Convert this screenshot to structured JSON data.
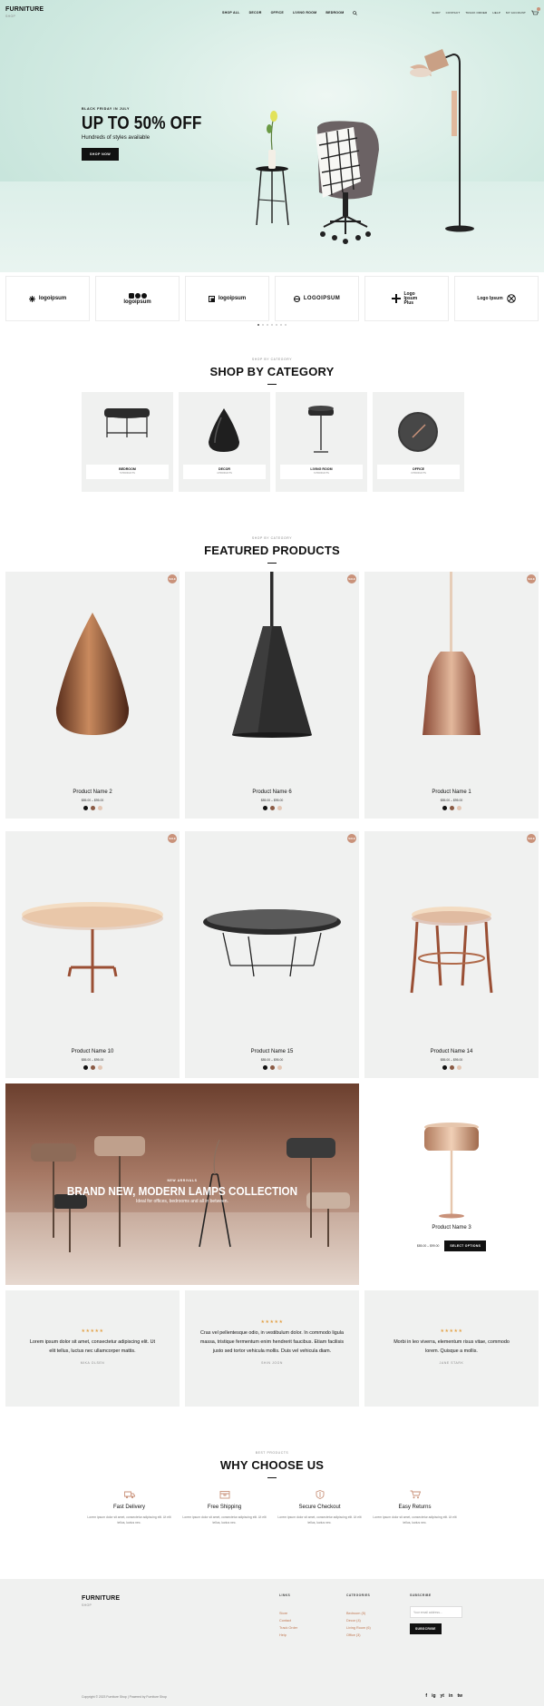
{
  "brand": {
    "name": "FURNITURE",
    "tag": "SHOP"
  },
  "nav": {
    "items": [
      "SHOP ALL",
      "DECOR",
      "OFFICE",
      "LIVING ROOM",
      "BEDROOM"
    ]
  },
  "utility": {
    "items": [
      "SHOP",
      "CONTACT",
      "TRACK ORDER",
      "HELP",
      "MY ACCOUNT"
    ],
    "cart_count": "0"
  },
  "hero": {
    "eyebrow": "BLACK FRIDAY IN JULY",
    "headline": "UP TO 50% OFF",
    "subline": "Hundreds of styles available",
    "cta": "SHOP NOW"
  },
  "logos": [
    "logoipsum",
    "logoipsum",
    "logoipsum",
    "LOGOIPSUM",
    "Logo Ipsum Plus",
    "Logo Ipsum"
  ],
  "categories_section": {
    "eyebrow": "SHOP BY CATEGORY",
    "title": "SHOP BY CATEGORY"
  },
  "categories": [
    {
      "name": "BEDROOM",
      "count": "5 PRODUCTS"
    },
    {
      "name": "DECOR",
      "count": "4 PRODUCTS"
    },
    {
      "name": "LIVING ROOM",
      "count": "6 PRODUCTS"
    },
    {
      "name": "OFFICE",
      "count": "3 PRODUCTS"
    }
  ],
  "featured_section": {
    "eyebrow": "SHOP BY CATEGORY",
    "title": "FEATURED PRODUCTS"
  },
  "products": [
    {
      "name": "Product Name 2",
      "price": "$85.00 – $95.00",
      "badge": "SALE"
    },
    {
      "name": "Product Name 6",
      "price": "$85.00 – $95.00",
      "badge": "SALE"
    },
    {
      "name": "Product Name 1",
      "price": "$85.00 – $95.00",
      "badge": "SALE"
    },
    {
      "name": "Product Name 10",
      "price": "$85.00 – $95.00",
      "badge": "SALE"
    },
    {
      "name": "Product Name 15",
      "price": "$85.00 – $95.00",
      "badge": "SALE"
    },
    {
      "name": "Product Name 14",
      "price": "$85.00 – $95.00",
      "badge": "SALE"
    }
  ],
  "swatch_colors": [
    "#111111",
    "#8a5a44",
    "#e3c6b4"
  ],
  "promo": {
    "eyebrow": "NEW ARRIVALS",
    "title": "BRAND NEW, MODERN LAMPS COLLECTION",
    "subtitle": "Ideal for offices, bedrooms and all in between."
  },
  "featured_single": {
    "name": "Product Name 3",
    "price": "$85.00 – $99.00",
    "cta": "SELECT OPTIONS"
  },
  "testimonials": [
    {
      "quote": "Lorem ipsum dolor sit amet, consectetur adipiscing elit. Ut elit tellus, luctus nec ullamcorper mattis.",
      "author": "MIKA OLSEN"
    },
    {
      "quote": "Cras vel pellentesque odio, in vestibulum dolor. In commodo ligula massa, tristique fermentum enim hendrerit faucibus. Etiam facilisis justo sed tortor vehicula mollis. Duis vel vehicula diam.",
      "author": "SHIN JOON"
    },
    {
      "quote": "Morbi in leo viverra, elementum risus vitae, commodo lorem. Quisque a mollis.",
      "author": "JANE STARK"
    }
  ],
  "why_section": {
    "eyebrow": "BEST PRODUCTS",
    "title": "WHY CHOOSE US"
  },
  "why": [
    {
      "title": "Fast Delivery",
      "text": "Lorem ipsum dolor sit amet, consectetur adipiscing elit. Ut elit tellus, luctus nec.",
      "icon": "truck-icon"
    },
    {
      "title": "Free Shipping",
      "text": "Lorem ipsum dolor sit amet, consectetur adipiscing elit. Ut elit tellus, luctus nec.",
      "icon": "box-icon"
    },
    {
      "title": "Secure Checkout",
      "text": "Lorem ipsum dolor sit amet, consectetur adipiscing elit. Ut elit tellus, luctus nec.",
      "icon": "shield-icon"
    },
    {
      "title": "Easy Returns",
      "text": "Lorem ipsum dolor sit amet, consectetur adipiscing elit. Ut elit tellus, luctus nec.",
      "icon": "cart-icon"
    }
  ],
  "footer": {
    "links_title": "LINKS",
    "links": [
      "Store",
      "Contact",
      "Track Order",
      "Help"
    ],
    "categories_title": "CATEGORIES",
    "categories": [
      "Bedroom (5)",
      "Decor (4)",
      "Living Room (6)",
      "Office (3)"
    ],
    "subscribe_title": "SUBSCRIBE",
    "email_placeholder": "Your email address...",
    "subscribe_cta": "SUBSCRIBE",
    "copyright": "Copyright © 2023 Furniture Shop | Powered by Furniture Shop",
    "social": [
      "f",
      "ig",
      "yt",
      "in",
      "tw"
    ]
  },
  "colors": {
    "accent": "#c9927a",
    "dark": "#111111",
    "panel": "#f0f1f0",
    "star": "#e3a34a"
  }
}
